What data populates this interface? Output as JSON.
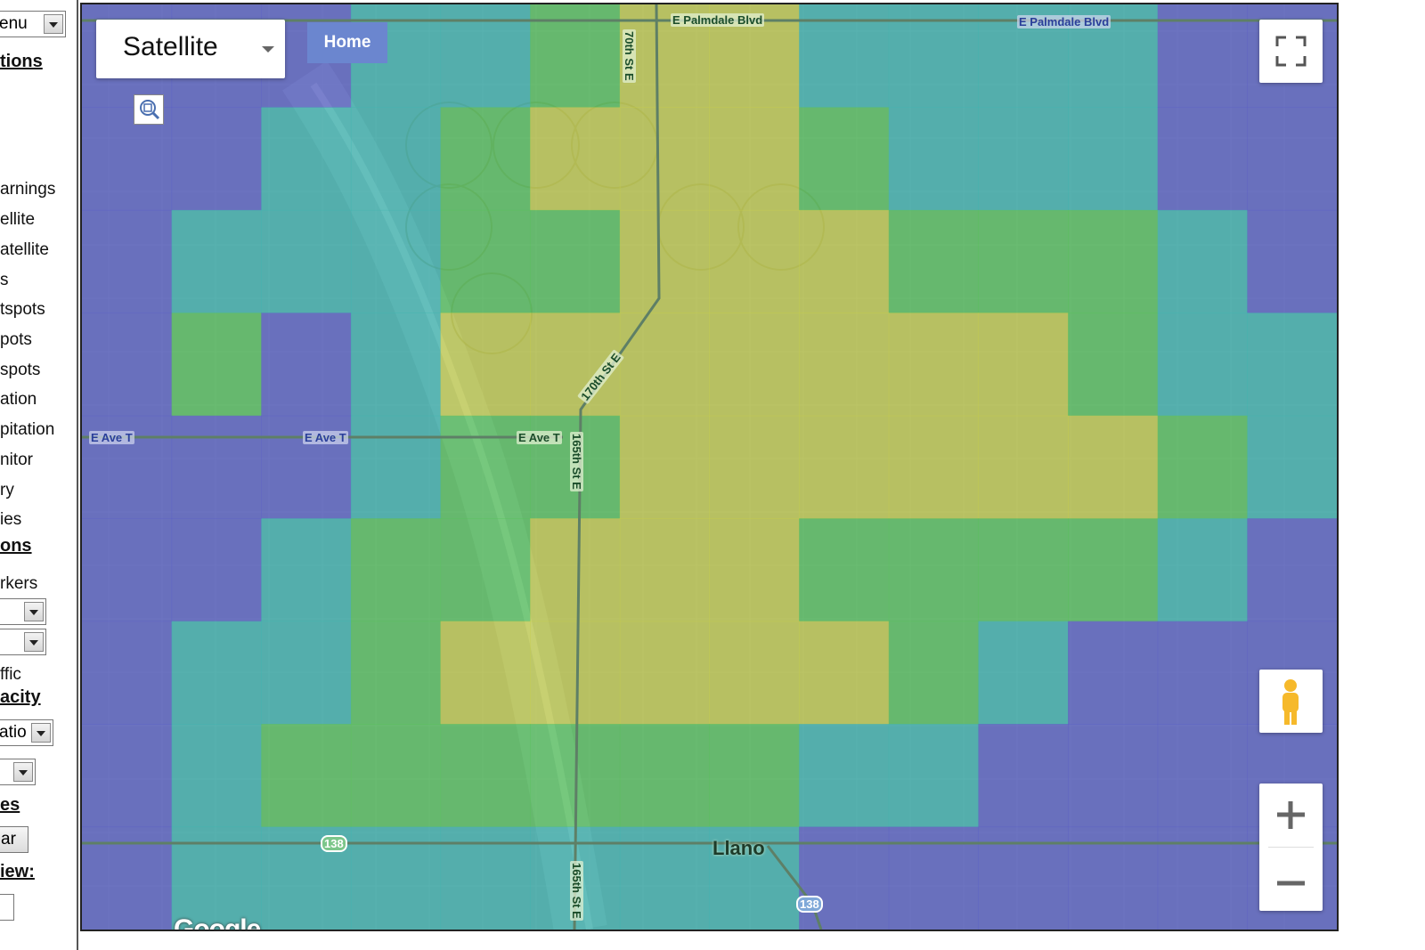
{
  "sidebar": {
    "menu_select": "enu",
    "options_heading": "tions",
    "layers": [
      "arnings",
      "ellite",
      "atellite",
      "s",
      "tspots",
      "pots",
      "spots",
      "ation",
      "pitation",
      "nitor",
      "ry",
      "ies"
    ],
    "overlays_heading": "ons",
    "markers_label": "rkers",
    "select_two": "",
    "select_three": "",
    "traffic_label": "ffic",
    "opacity_heading": "acity",
    "opacity_select": "atio",
    "select_five": "",
    "es_heading": "es",
    "clear_button": "ar",
    "view_heading": "iew:",
    "select_six": ""
  },
  "map": {
    "map_type": "Satellite",
    "home_label": "Home",
    "google_logo": "Google",
    "place_label": "Llano",
    "road_labels": {
      "palmdale_1": "E Palmdale Blvd",
      "palmdale_2": "E Palmdale Blvd",
      "ave_t_1": "E Ave T",
      "ave_t_2": "E Ave T",
      "ave_t_3": "E Ave T",
      "st_170_top": "70th St E",
      "st_170_diag": "170th St E",
      "st_165_mid": "165th St E",
      "st_165_bottom": "165th St E",
      "hwy_138_a": "138",
      "hwy_138_b": "138"
    },
    "colors": {
      "heat_low": "#5b5fc7",
      "heat_mid": "#3fb6b0",
      "heat_green": "#58c45a",
      "heat_high": "#c8cf4a"
    }
  },
  "heatmap": {
    "cols": 14,
    "rows": 9,
    "levels": [
      [
        0,
        0,
        0,
        1,
        1,
        2,
        3,
        3,
        1,
        1,
        1,
        1,
        0,
        0
      ],
      [
        0,
        0,
        1,
        1,
        2,
        3,
        3,
        3,
        2,
        1,
        1,
        1,
        0,
        0
      ],
      [
        0,
        1,
        1,
        1,
        2,
        2,
        3,
        3,
        3,
        2,
        2,
        2,
        1,
        0
      ],
      [
        0,
        2,
        0,
        1,
        3,
        3,
        3,
        3,
        3,
        3,
        3,
        2,
        1,
        1
      ],
      [
        0,
        0,
        0,
        1,
        2,
        2,
        3,
        3,
        3,
        3,
        3,
        3,
        2,
        1
      ],
      [
        0,
        0,
        1,
        2,
        2,
        3,
        3,
        3,
        2,
        2,
        2,
        2,
        1,
        0
      ],
      [
        0,
        1,
        1,
        2,
        3,
        3,
        3,
        3,
        3,
        2,
        1,
        0,
        0,
        0
      ],
      [
        0,
        1,
        2,
        2,
        2,
        2,
        2,
        2,
        1,
        1,
        0,
        0,
        0,
        0
      ],
      [
        0,
        1,
        1,
        1,
        1,
        1,
        1,
        1,
        0,
        0,
        0,
        0,
        0,
        0
      ]
    ]
  }
}
